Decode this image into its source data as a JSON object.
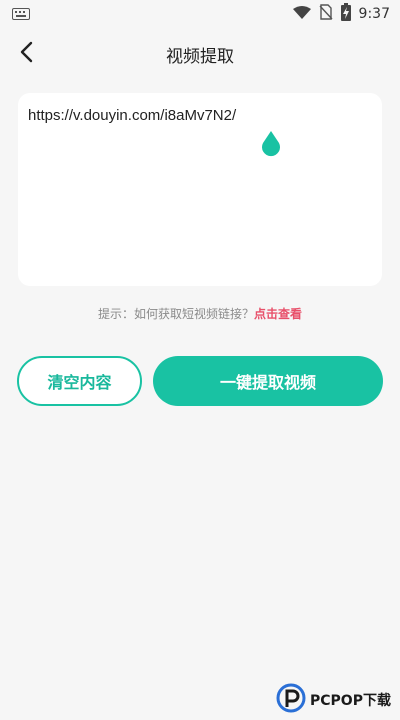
{
  "status_bar": {
    "time": "9:37",
    "icons": [
      "keyboard-icon",
      "wifi-icon",
      "no-sim-icon",
      "battery-charging-icon"
    ]
  },
  "app_bar": {
    "title": "视频提取",
    "back_icon": "back-arrow-icon"
  },
  "input": {
    "value": "https://v.douyin.com/i8aMv7N2/"
  },
  "hint": {
    "prefix": "提示：如何获取短视频链接？",
    "link": "点击查看"
  },
  "buttons": {
    "clear_label": "清空内容",
    "extract_label": "一键提取视频"
  },
  "watermark": {
    "text": "PCPOP下载"
  },
  "colors": {
    "accent": "#19c2a3",
    "link": "#e8506a",
    "background": "#f6f6f6"
  }
}
